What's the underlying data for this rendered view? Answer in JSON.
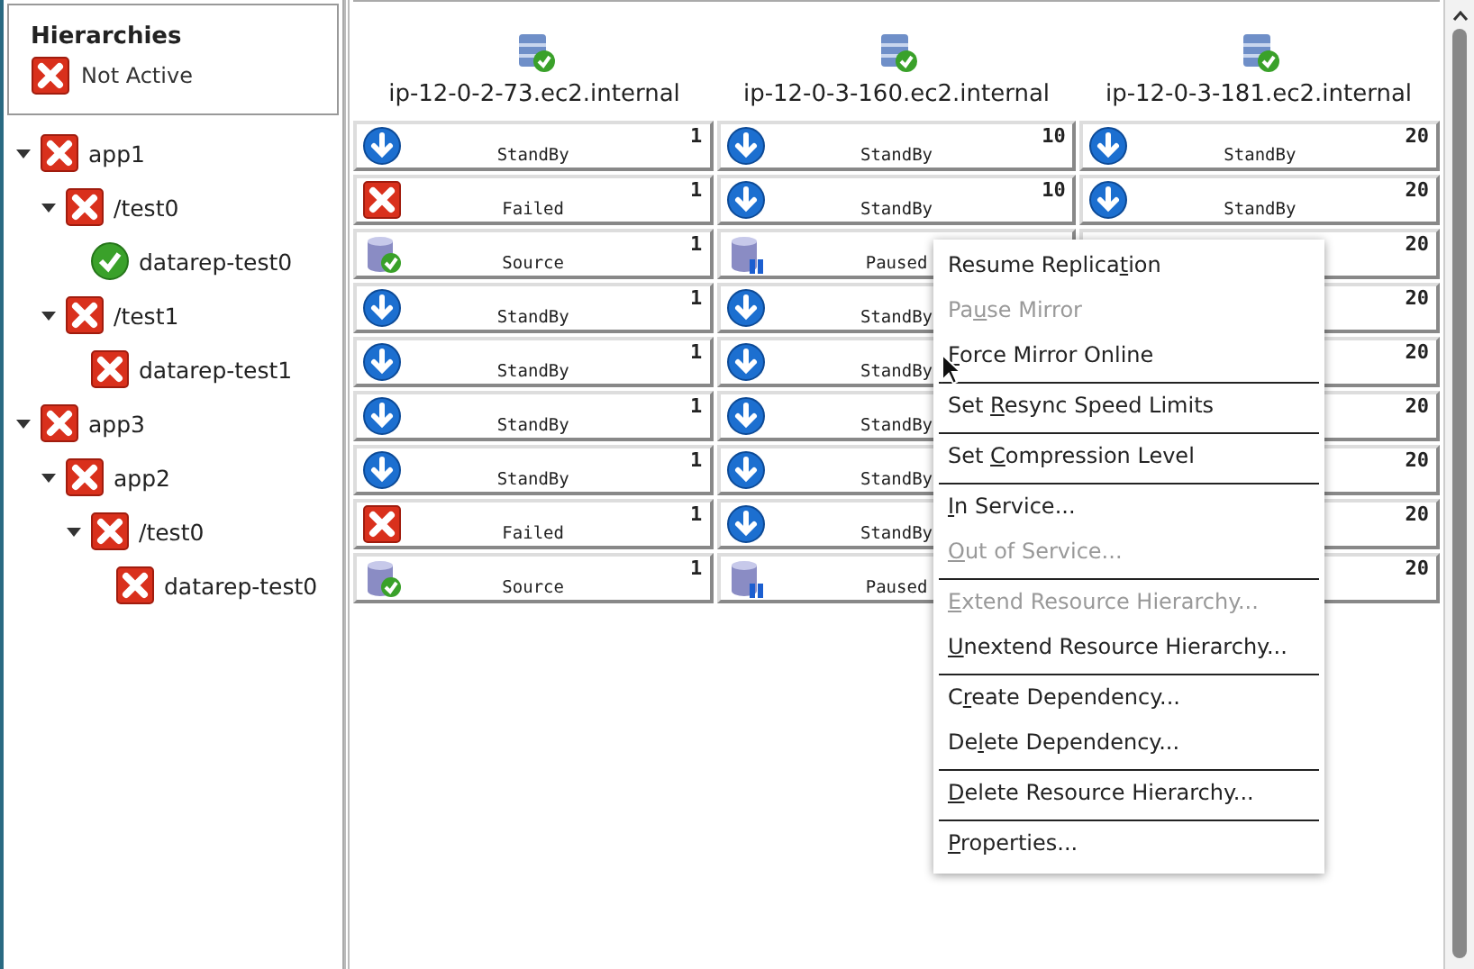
{
  "sidebar": {
    "title": "Hierarchies",
    "legend": {
      "kind": "failed",
      "label": "Not Active"
    },
    "tree": [
      {
        "label": "app1",
        "kind": "failed",
        "expanded": true,
        "children": [
          {
            "label": "/test0",
            "kind": "failed",
            "expanded": true,
            "children": [
              {
                "label": "datarep-test0",
                "kind": "ok"
              }
            ]
          },
          {
            "label": "/test1",
            "kind": "failed",
            "expanded": true,
            "children": [
              {
                "label": "datarep-test1",
                "kind": "failed"
              }
            ]
          }
        ]
      },
      {
        "label": "app3",
        "kind": "failed",
        "expanded": true,
        "children": [
          {
            "label": "app2",
            "kind": "failed",
            "expanded": true,
            "children": [
              {
                "label": "/test0",
                "kind": "failed",
                "expanded": true,
                "children": [
                  {
                    "label": "datarep-test0",
                    "kind": "failed"
                  }
                ]
              }
            ]
          }
        ]
      }
    ]
  },
  "servers": [
    {
      "name": "ip-12-0-2-73.ec2.internal"
    },
    {
      "name": "ip-12-0-3-160.ec2.internal"
    },
    {
      "name": "ip-12-0-3-181.ec2.internal"
    }
  ],
  "rows": [
    [
      {
        "kind": "standby",
        "status": "StandBy",
        "priority": "1"
      },
      {
        "kind": "standby",
        "status": "StandBy",
        "priority": "10"
      },
      {
        "kind": "standby",
        "status": "StandBy",
        "priority": "20"
      }
    ],
    [
      {
        "kind": "failed",
        "status": "Failed",
        "priority": "1"
      },
      {
        "kind": "standby",
        "status": "StandBy",
        "priority": "10"
      },
      {
        "kind": "standby",
        "status": "StandBy",
        "priority": "20"
      }
    ],
    [
      {
        "kind": "source",
        "status": "Source",
        "priority": "1"
      },
      {
        "kind": "paused",
        "status": "Paused"
      },
      {
        "priority": "20"
      }
    ],
    [
      {
        "kind": "standby",
        "status": "StandBy",
        "priority": "1"
      },
      {
        "kind": "standby",
        "status": "StandBy"
      },
      {
        "priority": "20"
      }
    ],
    [
      {
        "kind": "standby",
        "status": "StandBy",
        "priority": "1"
      },
      {
        "kind": "standby",
        "status": "StandBy"
      },
      {
        "priority": "20"
      }
    ],
    [
      {
        "kind": "standby",
        "status": "StandBy",
        "priority": "1"
      },
      {
        "kind": "standby",
        "status": "StandBy"
      },
      {
        "priority": "20"
      }
    ],
    [
      {
        "kind": "standby",
        "status": "StandBy",
        "priority": "1"
      },
      {
        "kind": "standby",
        "status": "StandBy"
      },
      {
        "priority": "20"
      }
    ],
    [
      {
        "kind": "failed",
        "status": "Failed",
        "priority": "1"
      },
      {
        "kind": "standby",
        "status": "StandBy"
      },
      {
        "priority": "20"
      }
    ],
    [
      {
        "kind": "source",
        "status": "Source",
        "priority": "1"
      },
      {
        "kind": "paused",
        "status": "Paused"
      },
      {
        "priority": "20"
      }
    ]
  ],
  "context_menu": {
    "groups": [
      [
        {
          "before": "Resume Replica",
          "key": "t",
          "after": "ion",
          "disabled": false
        },
        {
          "before": "Pa",
          "key": "u",
          "after": "se Mirror",
          "disabled": true
        },
        {
          "key": "F",
          "after": "orce Mirror Online",
          "disabled": false
        }
      ],
      [
        {
          "before": "Set ",
          "key": "R",
          "after": "esync Speed Limits",
          "disabled": false
        }
      ],
      [
        {
          "before": "Set ",
          "key": "C",
          "after": "ompression Level",
          "disabled": false
        }
      ],
      [
        {
          "key": "I",
          "after": "n Service...",
          "disabled": false
        },
        {
          "key": "O",
          "after": "ut of Service...",
          "disabled": true
        }
      ],
      [
        {
          "key": "E",
          "after": "xtend Resource Hierarchy...",
          "disabled": true
        },
        {
          "key": "U",
          "after": "nextend Resource Hierarchy...",
          "disabled": false
        }
      ],
      [
        {
          "before": "C",
          "key": "r",
          "after": "eate Dependency...",
          "disabled": false
        },
        {
          "before": "De",
          "key": "l",
          "after": "ete Dependency...",
          "disabled": false
        }
      ],
      [
        {
          "key": "D",
          "after": "elete Resource Hierarchy...",
          "disabled": false
        }
      ],
      [
        {
          "key": "P",
          "after": "roperties...",
          "disabled": false
        }
      ]
    ]
  }
}
